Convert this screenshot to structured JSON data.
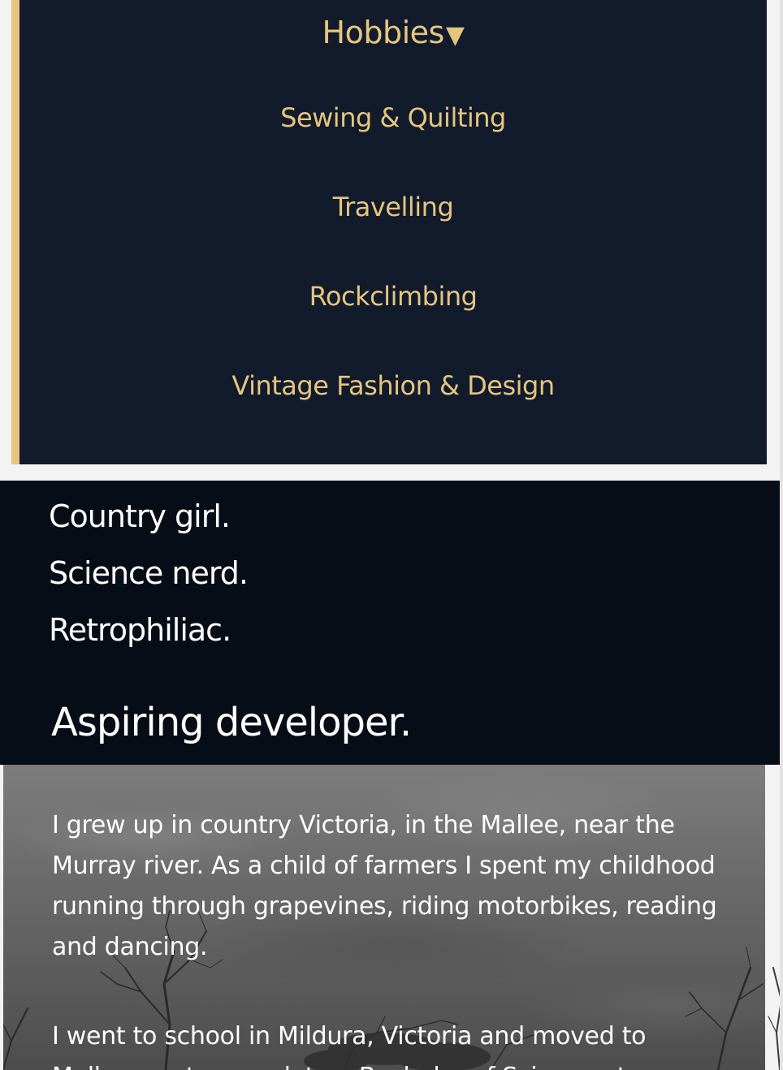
{
  "hobbies_menu": {
    "toggle_label": "Hobbies",
    "toggle_icon": "triangle-down-icon",
    "items": [
      {
        "label": "Sewing & Quilting"
      },
      {
        "label": "Travelling"
      },
      {
        "label": "Rockclimbing"
      },
      {
        "label": "Vintage Fashion & Design"
      }
    ]
  },
  "intro": {
    "lines": [
      "Country girl.",
      "Science nerd.",
      "Retrophiliac."
    ],
    "headline": "Aspiring developer."
  },
  "bio": {
    "paragraphs": [
      "I grew up in country Victoria, in the Mallee, near the Murray river. As a child of farmers I spent my childhood running through grapevines, riding motorbikes, reading and dancing.",
      "I went to school in Mildura, Victoria and moved to Melbourne to complete a Bachelor of Science at"
    ]
  },
  "colors": {
    "accent": "#e6c57f",
    "menu_bg": "#111b2b",
    "intro_bg": "#070d16"
  }
}
